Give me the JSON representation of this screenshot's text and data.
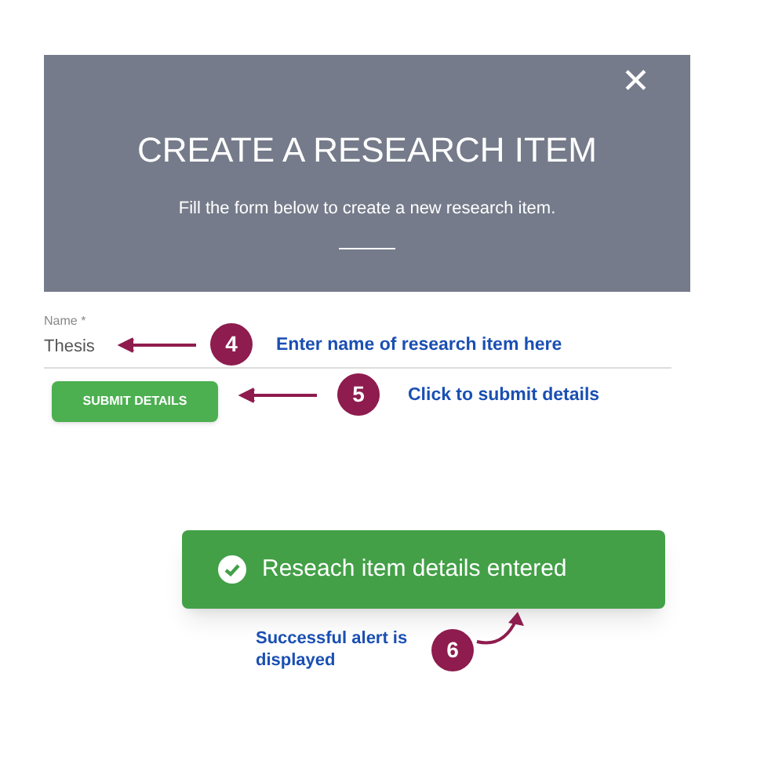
{
  "dialog": {
    "title": "CREATE A RESEARCH ITEM",
    "subtitle": "Fill the form below to create a new research item.",
    "close": "✕"
  },
  "form": {
    "field": {
      "label": "Name *",
      "value": "Thesis"
    },
    "submit_button": "SUBMIT DETAILS"
  },
  "toast": {
    "message": "Reseach item details entered"
  },
  "annotations": [
    {
      "number": "4",
      "text": "Enter name of research item here"
    },
    {
      "number": "5",
      "text": "Click to submit details"
    },
    {
      "number": "6",
      "text": "Successful alert is displayed"
    }
  ]
}
